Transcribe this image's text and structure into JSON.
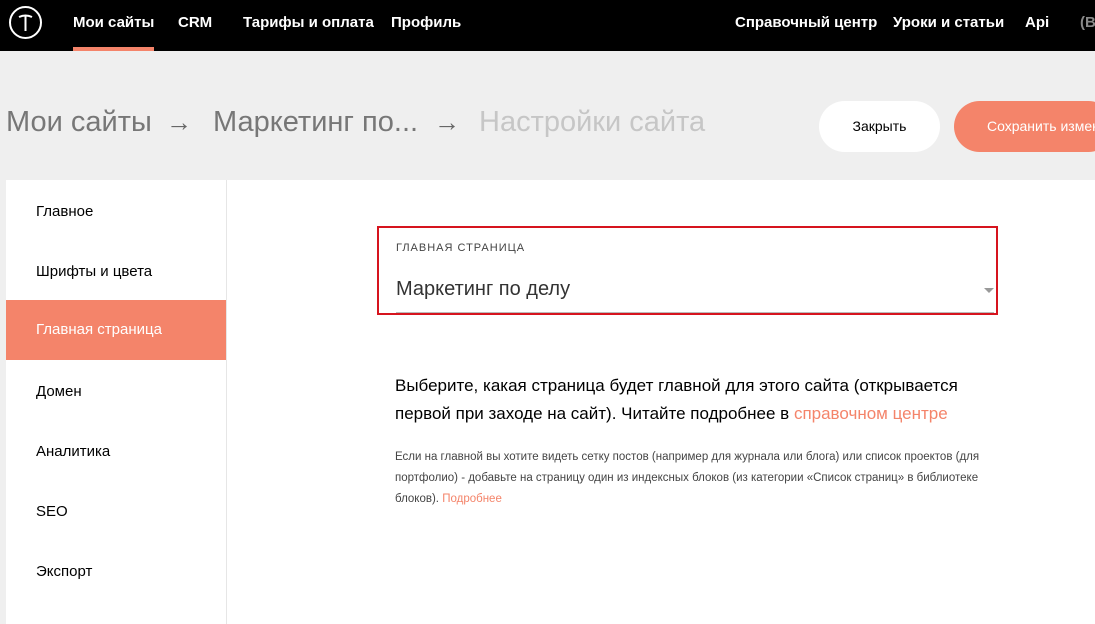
{
  "nav": {
    "items": [
      "Мои сайты",
      "CRM",
      "Тарифы и оплата",
      "Профиль"
    ],
    "right_items": [
      "Справочный центр",
      "Уроки и статьи",
      "Api",
      "(B"
    ]
  },
  "header": {
    "breadcrumbs": [
      "Мои сайты",
      "Маркетинг по...",
      "Настройки сайта"
    ],
    "arrow": "→",
    "close_label": "Закрыть",
    "save_label": "Сохранить изменения"
  },
  "sidebar": {
    "items": [
      "Главное",
      "Шрифты и цвета",
      "Главная страница",
      "Домен",
      "Аналитика",
      "SEO",
      "Экспорт"
    ],
    "active_index": 2
  },
  "main": {
    "field_label": "ГЛАВНАЯ СТРАНИЦА",
    "field_value": "Маркетинг по делу",
    "description": "Выберите, какая страница будет главной для этого сайта (открывается первой при заходе на сайт). Читайте подробнее в ",
    "description_link": "справочном центре",
    "note": "Если на главной вы хотите видеть сетку постов (например для журнала или блога) или список проектов (для портфолио) - добавьте на страницу один из индексных блоков (из категории «Список страниц» в библиотеке блоков). ",
    "note_link": "Подробнее"
  },
  "colors": {
    "accent": "#f4846a",
    "highlight": "#d6141e"
  }
}
